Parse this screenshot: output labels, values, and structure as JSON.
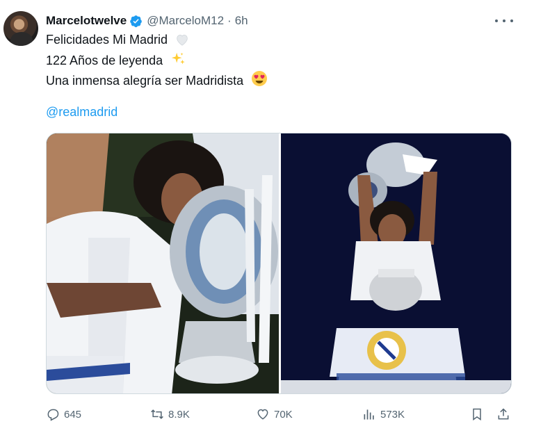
{
  "author": {
    "display_name": "Marcelotwelve",
    "handle": "@MarceloM12",
    "separator": "·",
    "time": "6h",
    "verified": true
  },
  "tweet": {
    "line1": "Felicidades Mi Madrid",
    "line1_emoji": "white-heart",
    "line2": "122 Años de leyenda",
    "line2_emoji": "sparkles",
    "line3": "Una inmensa alegría ser Madridista",
    "line3_emoji": "heart-eyes",
    "mention": "@realmadrid"
  },
  "media": {
    "photos": [
      {
        "description_icon": "trophy-kiss-photo"
      },
      {
        "description_icon": "trophy-celebration-photo"
      }
    ]
  },
  "actions": {
    "replies": "645",
    "retweets": "8.9K",
    "likes": "70K",
    "views": "573K"
  },
  "colors": {
    "accent": "#1d9bf0",
    "secondary_text": "#536471",
    "primary_text": "#0f1419"
  }
}
